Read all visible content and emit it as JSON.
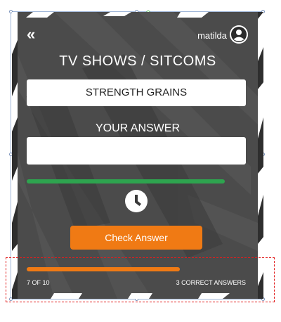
{
  "header": {
    "back_glyph": "«",
    "username": "matilda",
    "avatar_icon": "user-circle-icon"
  },
  "quiz": {
    "category": "TV SHOWS / SITCOMS",
    "scrambled_word": "STRENGTH GRAINS",
    "answer_label": "YOUR ANSWER",
    "answer_value": "",
    "timer_remaining_fraction": 0.95,
    "timer_icon": "clock-icon",
    "check_button_label": "Check Answer"
  },
  "footer": {
    "progress_fraction": 0.7,
    "question_counter": "7 OF 10",
    "correct_answers": "3 CORRECT ANSWERS"
  },
  "colors": {
    "card_bg": "#4a4a4a",
    "timer_green": "#2ea44f",
    "accent_orange": "#f07a14",
    "selection_red": "#e11d1d"
  }
}
